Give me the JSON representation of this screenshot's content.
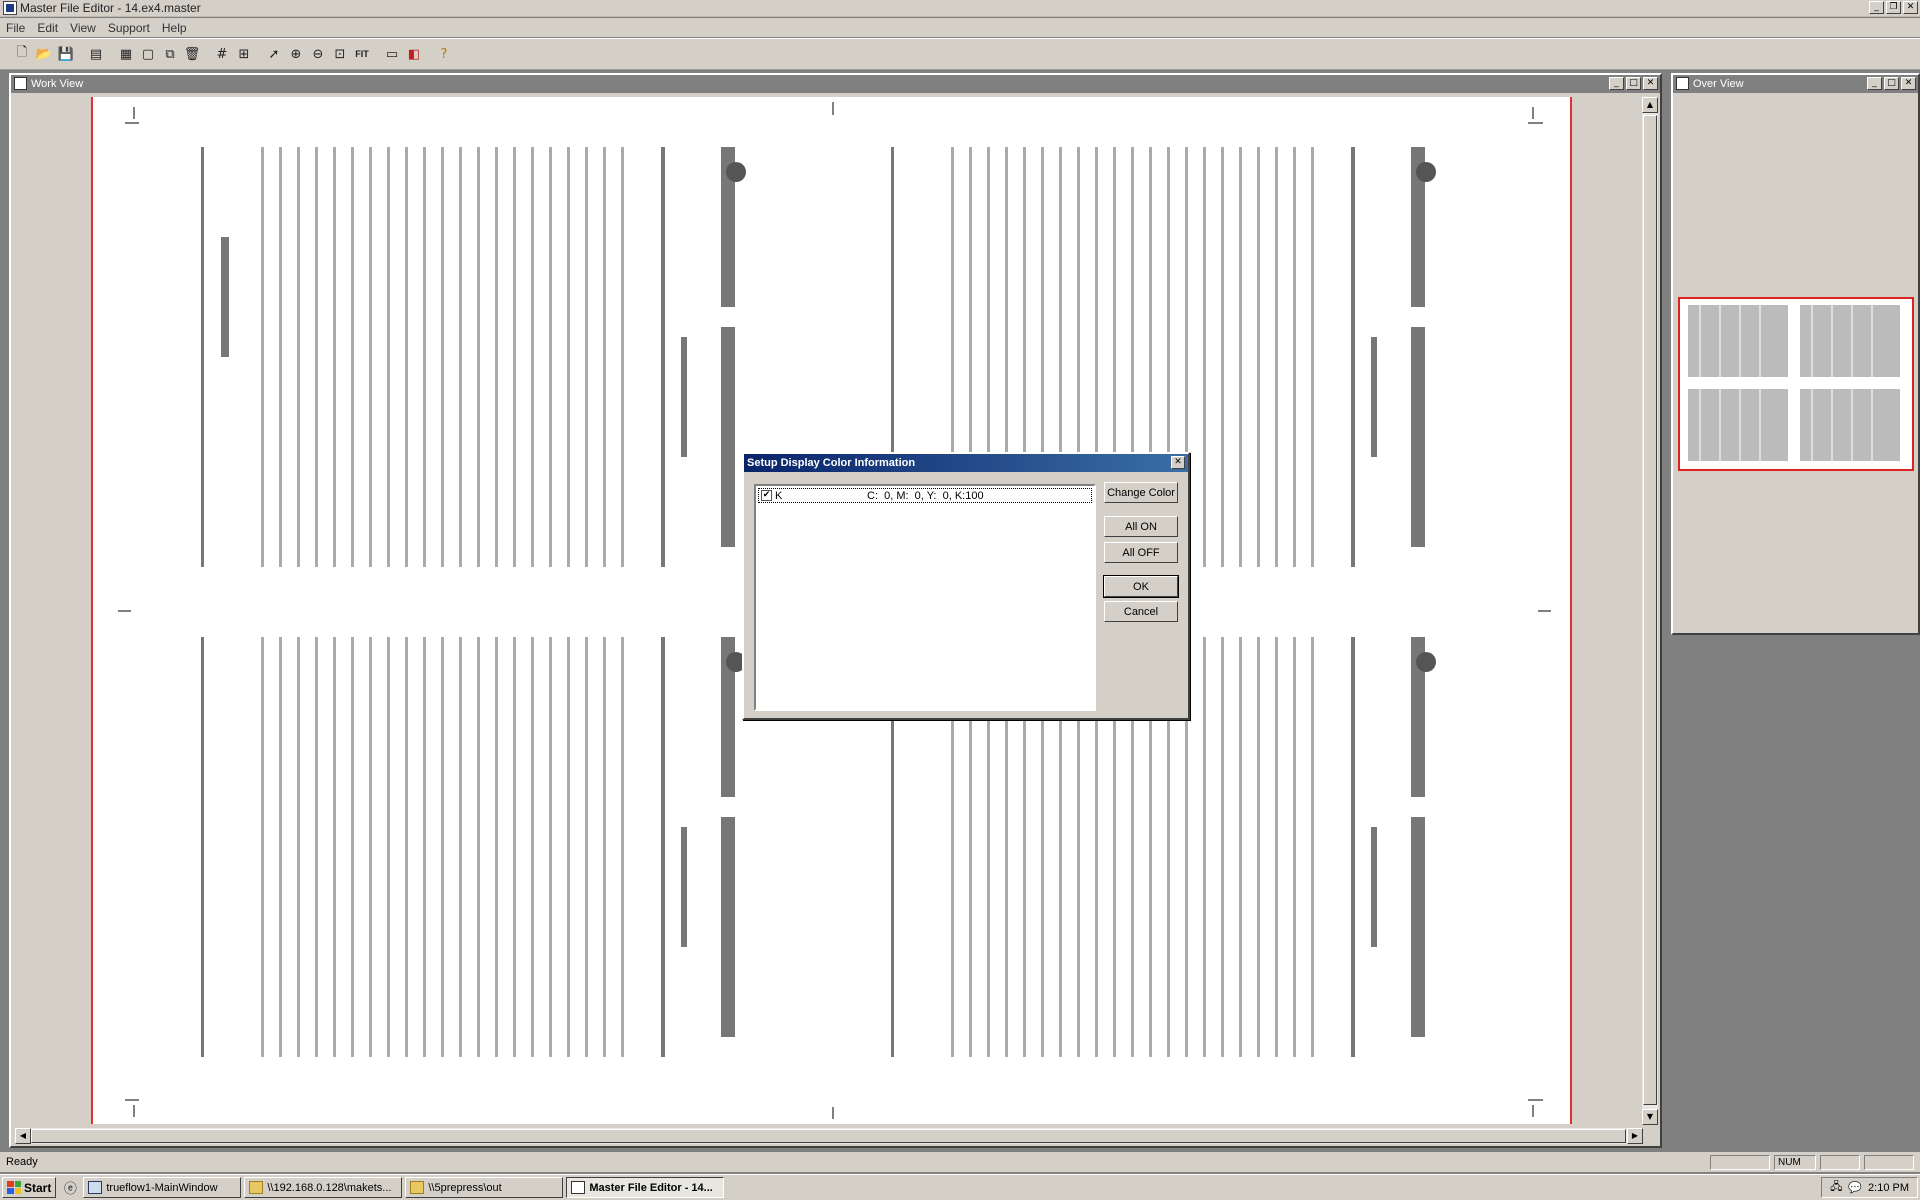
{
  "app": {
    "title": "Master File Editor - 14.ex4.master"
  },
  "menu": [
    "File",
    "Edit",
    "View",
    "Support",
    "Help"
  ],
  "toolbar": {
    "buttons": [
      "new-icon",
      "open-icon",
      "save-icon",
      "print-icon",
      "layout-icon",
      "window-icon",
      "tile-icon",
      "delete-icon",
      "grid-icon",
      "grid-fine-icon",
      "pointer-icon",
      "zoom-in-icon",
      "zoom-out-icon",
      "zoom-box-icon",
      "fit-icon",
      "ruler-icon",
      "color-icon",
      "help-icon"
    ],
    "fit_label": "FIT"
  },
  "work_view": {
    "title": "Work View"
  },
  "over_view": {
    "title": "Over View"
  },
  "dialog": {
    "title": "Setup Display Color Information",
    "colors": [
      {
        "name": "K",
        "checked": true,
        "value": "C:  0, M:  0, Y:  0, K:100"
      }
    ],
    "buttons": {
      "change_color": "Change Color",
      "all_on": "All ON",
      "all_off": "All OFF",
      "ok": "OK",
      "cancel": "Cancel"
    }
  },
  "status": {
    "text": "Ready",
    "num": "NUM"
  },
  "taskbar": {
    "start": "Start",
    "tasks": [
      {
        "label": "trueflow1-MainWindow",
        "active": false
      },
      {
        "label": "\\\\192.168.0.128\\makets...",
        "active": false
      },
      {
        "label": "\\\\5prepress\\out",
        "active": false
      },
      {
        "label": "Master File Editor - 14...",
        "active": true
      }
    ],
    "clock": "2:10 PM"
  },
  "colors": {
    "sheet_border": "#e03030",
    "dialog_caption": "#0a246a",
    "inactive_caption": "#808080"
  }
}
